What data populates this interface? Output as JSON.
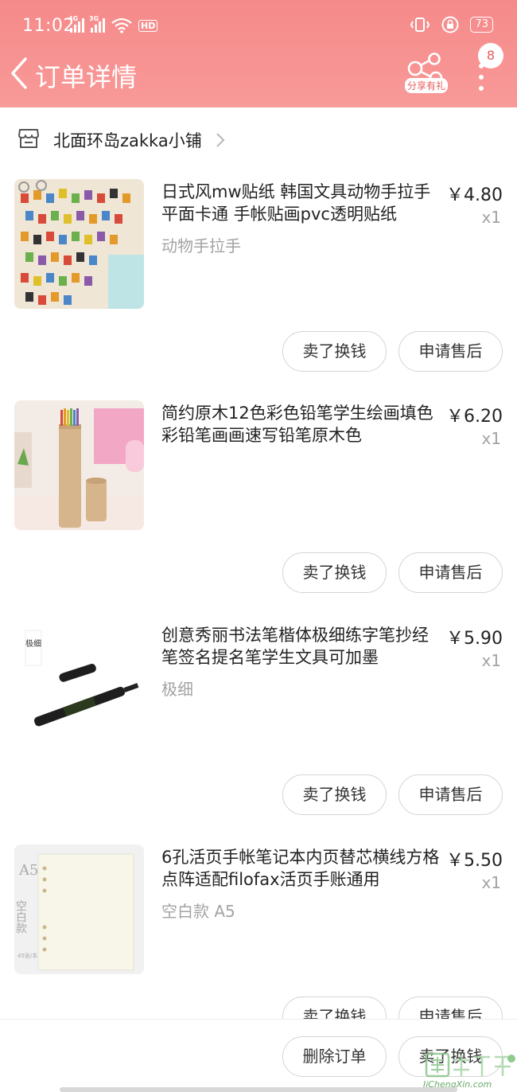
{
  "status": {
    "time": "11:02",
    "net1": "4G",
    "net2": "3G",
    "hd": "HD",
    "battery": "73"
  },
  "nav": {
    "title": "订单详情",
    "share_label": "分享有礼",
    "badge_count": "8"
  },
  "shop": {
    "name": "北面环岛zakka小铺"
  },
  "items": [
    {
      "title": "日式风mw贴纸 韩国文具动物手拉手平面卡通 手帐贴画pvc透明贴纸",
      "spec": "动物手拉手",
      "price": "￥4.80",
      "qty": "x1",
      "btn_sell": "卖了换钱",
      "btn_after": "申请售后"
    },
    {
      "title": "简约原木12色彩色铅笔学生绘画填色彩铅笔画画速写铅笔原木色",
      "spec": "",
      "price": "￥6.20",
      "qty": "x1",
      "btn_sell": "卖了换钱",
      "btn_after": "申请售后"
    },
    {
      "title": "创意秀丽书法笔楷体极细练字笔抄经笔签名提名笔学生文具可加墨",
      "spec": "极细",
      "price": "￥5.90",
      "qty": "x1",
      "btn_sell": "卖了换钱",
      "btn_after": "申请售后",
      "thumb_text": "极细"
    },
    {
      "title": "6孔活页手帐笔记本内页替芯横线方格点阵适配filofax活页手账通用",
      "spec": "空白款 A5",
      "price": "￥5.50",
      "qty": "x1",
      "btn_sell": "卖了换钱",
      "btn_after": "申请售后",
      "thumb_text_a5": "A5",
      "thumb_text_blank": "空白款",
      "thumb_text_small": "45张/本"
    }
  ],
  "bottom": {
    "delete_label": "删除订单",
    "sell_label": "卖了换钱"
  },
  "watermark": {
    "text": "JiChengXin.com"
  },
  "colors": {
    "header": "#f58a8a",
    "accent": "#e75a5a",
    "muted": "#a3a3a3"
  }
}
